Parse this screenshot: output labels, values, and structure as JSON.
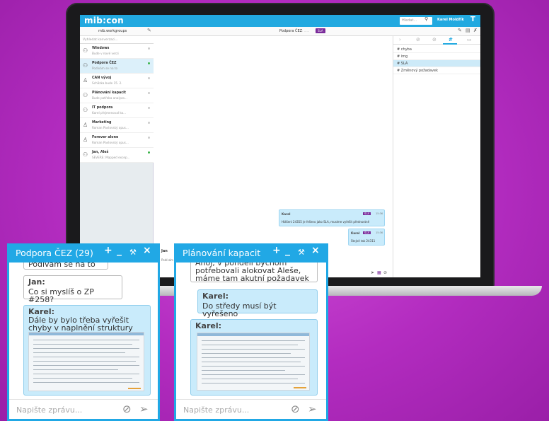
{
  "app": {
    "logo": "mib:con",
    "search_placeholder": "Hledat...",
    "user_name": "Karel Moldřík",
    "user_initial": "T"
  },
  "subbar": {
    "workspace": "mib.workgroups",
    "chat_title": "Podpora ČEZ",
    "chat_suffix": ": ......",
    "sla_label": "SLA"
  },
  "sidebar": {
    "search_placeholder": "Vyhledat konverzaci...",
    "conversations": [
      {
        "name": "Windows",
        "preview": "Bude v nové verzi",
        "online": false
      },
      {
        "name": "Podpora ČEZ",
        "preview": "Podívám se na to",
        "online": true
      },
      {
        "name": "CAN vývoj",
        "preview": "Schůzka bude 15. 2.",
        "online": false
      },
      {
        "name": "Plánování kapacit",
        "preview": "Bude potřeba analyzo...",
        "online": false
      },
      {
        "name": "IT podpora",
        "preview": "Karel přejmenoval ko...",
        "online": false
      },
      {
        "name": "Marketing",
        "preview": "Roman Pavlovský opus...",
        "online": false
      },
      {
        "name": "Forever alone",
        "preview": "Roman Pavlovský opus...",
        "online": false
      },
      {
        "name": "Jan, Aleš",
        "preview": "SEVERE: Mapped excep...",
        "online": true
      }
    ]
  },
  "main": {
    "messages": [
      {
        "author": "Karel",
        "tag": "SLA",
        "time": "15:36",
        "text": "Hlášení 24355 je řešeno jako SLA, musíme vyřešit přednostně"
      },
      {
        "author": "Karel",
        "tag": "SLA",
        "time": "15:36",
        "text": "Stejně tak 24311"
      }
    ]
  },
  "right_panel": {
    "tags": [
      "chyba",
      "img",
      "SLA",
      "Změnový požadavek"
    ],
    "selected_tag": "SLA"
  },
  "window1": {
    "title": "Podpora ČEZ (29)",
    "messages": [
      {
        "author": "",
        "text": "Podívám se na to"
      },
      {
        "author": "Jan:",
        "text": "Co si myslíš o ZP #258?"
      },
      {
        "author": "Karel:",
        "text": "Dále by bylo třeba vyřešit chyby v naplnění struktury"
      }
    ],
    "input_placeholder": "Napište zprávu..."
  },
  "window2": {
    "title": "Plánování kapacit",
    "messages": [
      {
        "author": "",
        "text": "Ahoj, v pondělí bychom potřebovali alokovat Aleše, máme tam akutní požadavek"
      },
      {
        "author": "Karel:",
        "text": "Do středy musí být vyřešeno"
      },
      {
        "author": "Karel:",
        "text": ""
      }
    ],
    "input_placeholder": "Napište zprávu..."
  },
  "partial_left": {
    "name": "Jan",
    "preview": "Podívám"
  },
  "colors": {
    "accent": "#22a9e0",
    "sla": "#7a2a9a",
    "bubble": "#c9ebfb",
    "online": "#3cb34a"
  }
}
